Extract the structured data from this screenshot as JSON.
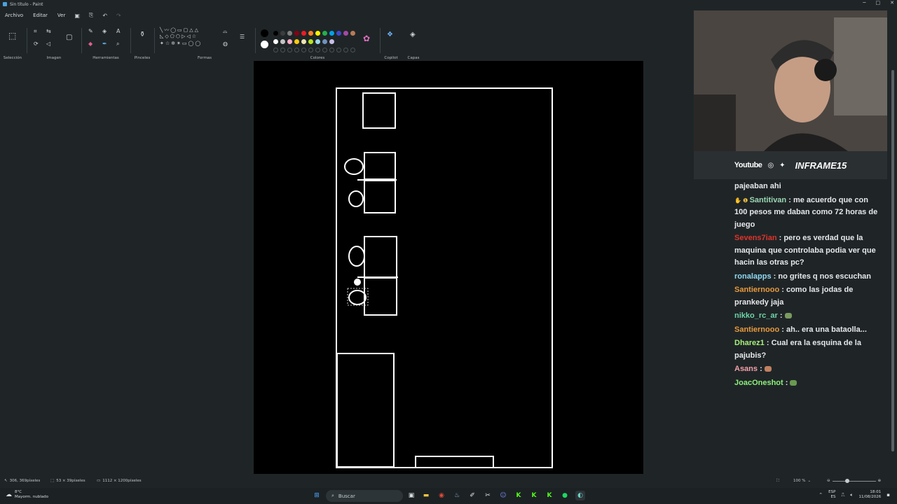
{
  "window": {
    "title": "Sin título - Paint",
    "controls": [
      "─",
      "□",
      "✕"
    ]
  },
  "menu": {
    "items": [
      "Archivo",
      "Editar",
      "Ver"
    ]
  },
  "ribbon": {
    "groups": {
      "selection": "Selección",
      "image": "Imagen",
      "tools": "Herramientas",
      "brushes": "Pinceles",
      "shapes": "Formas",
      "colors": "Colores",
      "copilot": "Copilot",
      "layers": "Capas"
    },
    "palette_top": [
      "#000000",
      "#3c3c3c",
      "#7f7f7f",
      "#880015",
      "#ed1c24",
      "#ff7f27",
      "#fff200",
      "#22b14c",
      "#00a2e8",
      "#3f48cc",
      "#a349a4",
      "#b97a57"
    ],
    "palette_bottom": [
      "#ffffff",
      "#c3c3c3",
      "#ffaec9",
      "#ffc90e",
      "#efe4b0",
      "#b5e61d",
      "#99d9ea",
      "#7092be",
      "#c8bfe7"
    ],
    "primary_color": "#000000",
    "secondary_color": "#ffffff"
  },
  "status": {
    "cursor_pos": "306, 369píxeles",
    "selection_size": "53 × 39píxeles",
    "canvas_size": "1112 × 1200píxeles",
    "zoom": "100 %"
  },
  "stream": {
    "youtube": "Youtube",
    "handle": "INFRAME15"
  },
  "chat": [
    {
      "user": "",
      "color": "#ffffff",
      "text": "pajeaban ahi"
    },
    {
      "user": "Santitivan",
      "color": "#9cd8b5",
      "text": "me acuerdo que con 100 pesos me daban como 72 horas de juego",
      "badges": true
    },
    {
      "user": "Sevens7ian",
      "color": "#e0332b",
      "text": "pero es verdad que la maquina que controlaba podia ver que hacin las otras pc?"
    },
    {
      "user": "ronalapps",
      "color": "#8fd9f2",
      "text": "no grites q nos escuchan"
    },
    {
      "user": "Santiernooo",
      "color": "#e89a3c",
      "text": "como las jodas de prankedy jaja"
    },
    {
      "user": "nikko_rc_ar",
      "color": "#6fd3a8",
      "text": "",
      "emote": "#7a9a60"
    },
    {
      "user": "Santiernooo",
      "color": "#e89a3c",
      "text": "ah.. era una bataolla..."
    },
    {
      "user": "Dharez1",
      "color": "#a6f07b",
      "text": "Cual era la esquina de la pajubis?"
    },
    {
      "user": "Asans",
      "color": "#f2a0a8",
      "text": "",
      "emote": "#c08060"
    },
    {
      "user": "JoacOneshot",
      "color": "#8cf07a",
      "text": "",
      "emote": "#6a9a50"
    }
  ],
  "taskbar": {
    "weather_temp": "8°C",
    "weather_desc": "Mayorm. nublado",
    "search_placeholder": "Buscar",
    "lang1": "ESP",
    "lang2": "ES",
    "time": "18:01",
    "date": "11/08/2026"
  }
}
